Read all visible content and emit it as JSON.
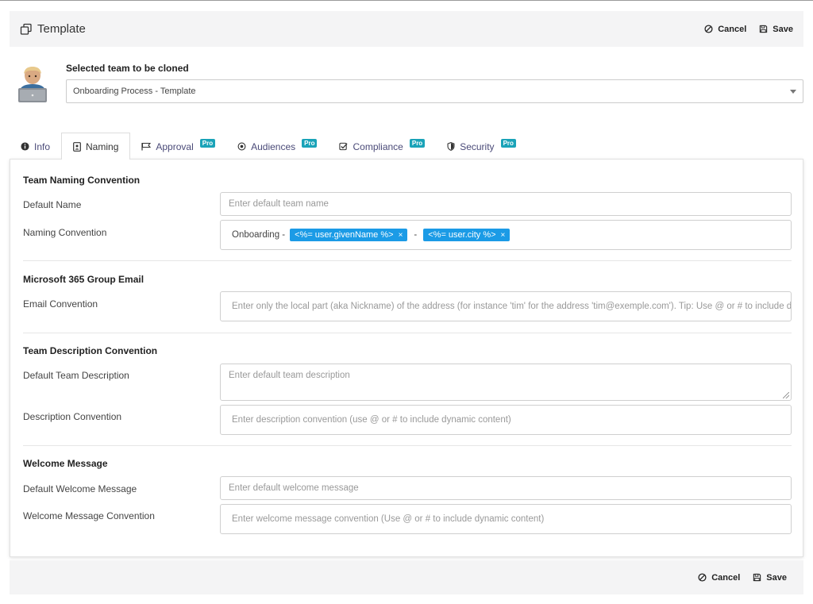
{
  "header": {
    "title": "Template",
    "cancel_label": "Cancel",
    "save_label": "Save"
  },
  "team": {
    "label": "Selected team to be cloned",
    "selected": "Onboarding Process - Template"
  },
  "tabs": [
    {
      "label": "Info",
      "icon": "info-circle-icon"
    },
    {
      "label": "Naming",
      "icon": "id-badge-icon"
    },
    {
      "label": "Approval",
      "icon": "flag-icon",
      "badge": "Pro"
    },
    {
      "label": "Audiences",
      "icon": "target-icon",
      "badge": "Pro"
    },
    {
      "label": "Compliance",
      "icon": "checkbox-icon",
      "badge": "Pro"
    },
    {
      "label": "Security",
      "icon": "shield-icon",
      "badge": "Pro"
    }
  ],
  "sections": {
    "naming": {
      "title": "Team Naming Convention",
      "default_name_label": "Default Name",
      "default_name_placeholder": "Enter default team name",
      "convention_label": "Naming Convention",
      "convention_prefix": "Onboarding -",
      "convention_chip1": "<%= user.givenName %>",
      "convention_separator": "-",
      "convention_chip2": "<%= user.city %>",
      "chip_remove": "×"
    },
    "email": {
      "title": "Microsoft 365 Group Email",
      "label": "Email Convention",
      "placeholder": "Enter only the local part (aka Nickname) of the address (for instance 'tim' for the address 'tim@exemple.com'). Tip: Use @ or # to include dynamic content"
    },
    "description": {
      "title": "Team Description Convention",
      "default_label": "Default Team Description",
      "default_placeholder": "Enter default team description",
      "convention_label": "Description Convention",
      "convention_placeholder": "Enter description convention (use @ or # to include dynamic content)"
    },
    "welcome": {
      "title": "Welcome Message",
      "default_label": "Default Welcome Message",
      "default_placeholder": "Enter default welcome message",
      "convention_label": "Welcome Message Convention",
      "convention_placeholder": "Enter welcome message convention (Use @ or # to include dynamic content)"
    }
  },
  "footer": {
    "cancel_label": "Cancel",
    "save_label": "Save"
  },
  "colors": {
    "chip": "#1b9be6",
    "pro_badge": "#1aa3b8",
    "tab_text": "#4a4a78"
  }
}
